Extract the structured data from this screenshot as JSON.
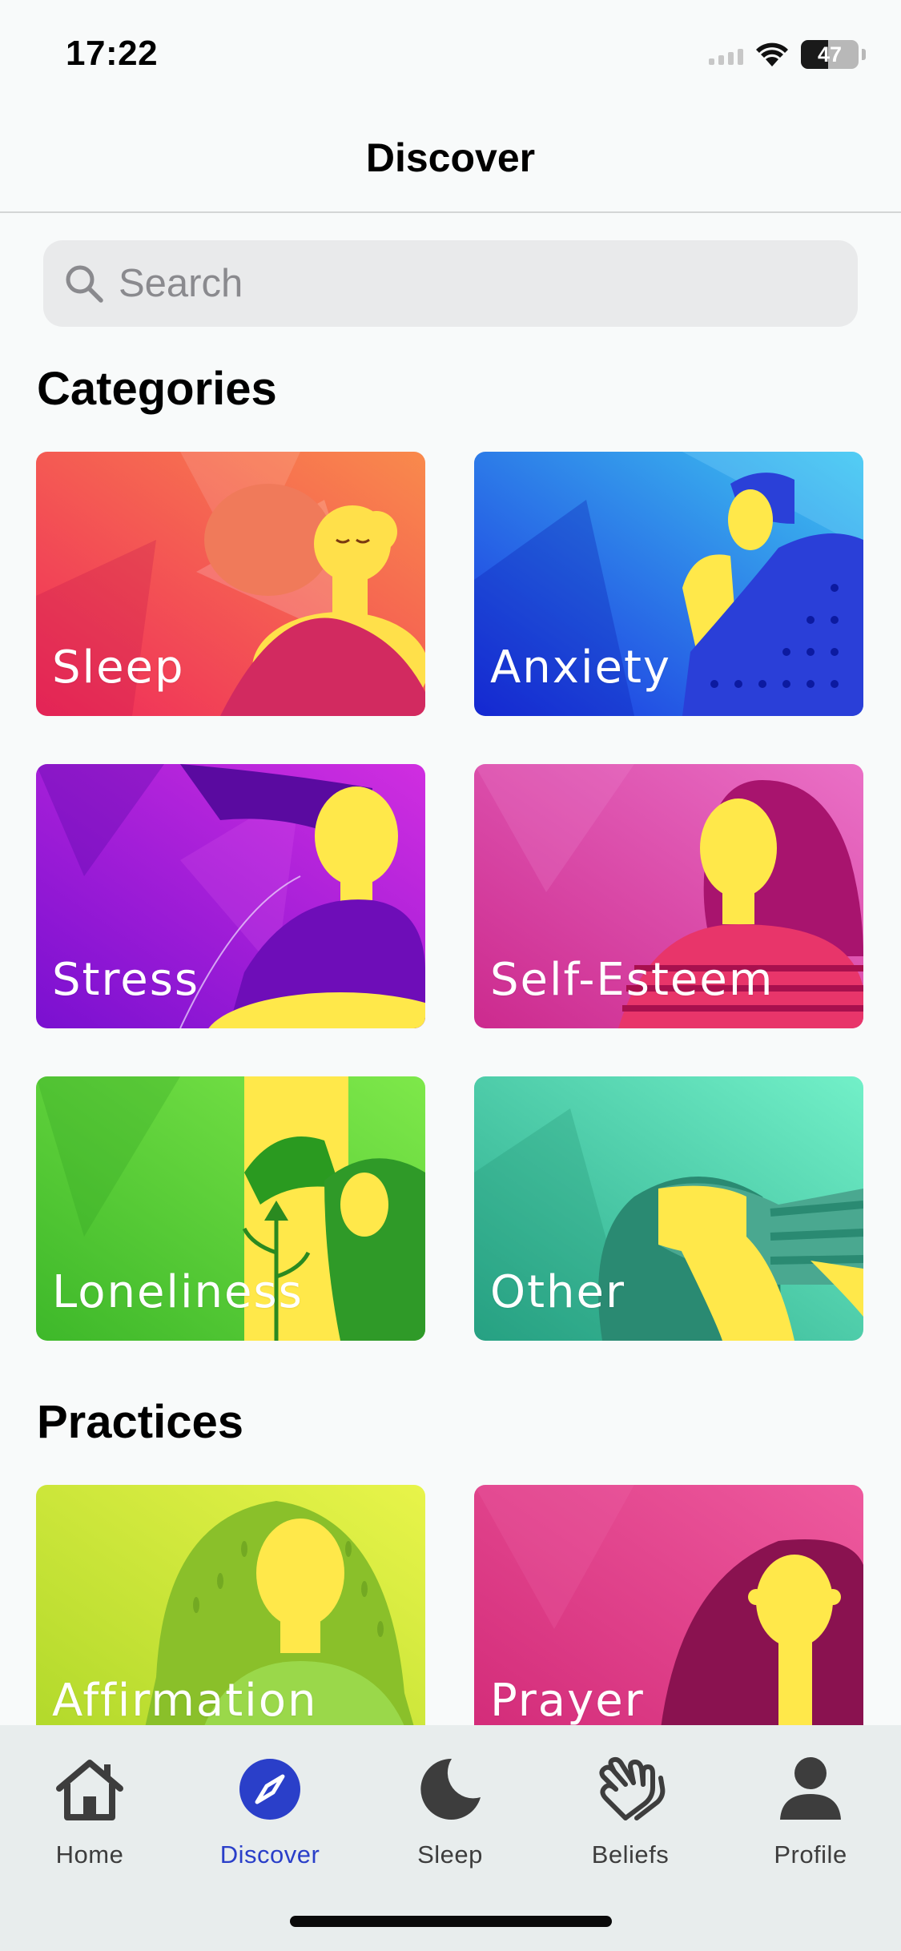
{
  "status_bar": {
    "time": "17:22",
    "battery_percent": "47"
  },
  "nav": {
    "title": "Discover"
  },
  "search": {
    "placeholder": "Search"
  },
  "sections": {
    "categories_title": "Categories",
    "practices_title": "Practices"
  },
  "categories": [
    {
      "label": "Sleep",
      "color_a": "#ef2a5a",
      "color_b": "#f98a4c"
    },
    {
      "label": "Anxiety",
      "color_a": "#1f4fe8",
      "color_b": "#3fc8f0"
    },
    {
      "label": "Stress",
      "color_a": "#8a18d8",
      "color_b": "#d02ee0"
    },
    {
      "label": "Self-Esteem",
      "color_a": "#d6338e",
      "color_b": "#e86cc0"
    },
    {
      "label": "Loneliness",
      "color_a": "#46c832",
      "color_b": "#7ee84a"
    },
    {
      "label": "Other",
      "color_a": "#2fbf92",
      "color_b": "#6fe8c0"
    }
  ],
  "practices": [
    {
      "label": "Affirmation",
      "color_a": "#b8e02a",
      "color_b": "#e4f04a"
    },
    {
      "label": "Prayer",
      "color_a": "#d62a7a",
      "color_b": "#ee5aa2"
    }
  ],
  "tabs": [
    {
      "label": "Home",
      "icon": "house-icon"
    },
    {
      "label": "Discover",
      "icon": "compass-icon"
    },
    {
      "label": "Sleep",
      "icon": "moon-icon"
    },
    {
      "label": "Beliefs",
      "icon": "praying-hands-icon"
    },
    {
      "label": "Profile",
      "icon": "person-icon"
    }
  ],
  "active_tab": "Discover",
  "colors": {
    "accent": "#2a3fc9",
    "background": "#f8fafa",
    "tab_bar": "#e8eded"
  }
}
